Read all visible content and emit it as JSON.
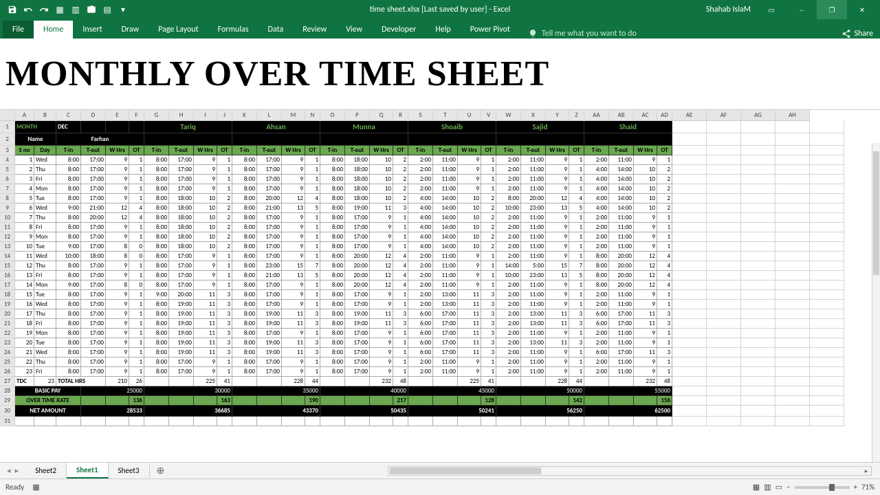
{
  "title": "time sheet.xlsx [Last saved by user]  -  Excel",
  "user": "Shahab IslaM",
  "ribbon": {
    "file": "File",
    "home": "Home",
    "insert": "Insert",
    "draw": "Draw",
    "layout": "Page Layout",
    "formulas": "Formulas",
    "data": "Data",
    "review": "Review",
    "view": "View",
    "dev": "Developer",
    "help": "Help",
    "pp": "Power Pivot",
    "tell": "Tell me what you want to do",
    "share": "Share"
  },
  "heading": "MONTHLY OVER TIME SHEET",
  "cols": [
    "A",
    "B",
    "C",
    "D",
    "E",
    "F",
    "G",
    "H",
    "I",
    "J",
    "K",
    "L",
    "M",
    "N",
    "O",
    "P",
    "Q",
    "R",
    "S",
    "T",
    "U",
    "V",
    "W",
    "X",
    "Y",
    "Z",
    "AA",
    "AB",
    "AC",
    "AD",
    "AE",
    "AF",
    "AG",
    "AH"
  ],
  "month_label": "MONTH",
  "month": "DEC",
  "name_label": "Name",
  "employees": [
    "Farhan",
    "Tariq",
    "Ahsan",
    "Munna",
    "Shoaib",
    "Sajid",
    "Shaid"
  ],
  "col_headers": [
    "S no",
    "Day",
    "T-in",
    "T-out",
    "W Hrs",
    "OT"
  ],
  "rown": [
    4,
    5,
    6,
    7,
    8,
    9,
    10,
    11,
    12,
    13,
    14,
    15,
    16,
    17,
    18,
    19,
    20,
    21,
    22,
    23,
    24,
    25,
    26,
    27,
    28,
    29,
    30,
    31
  ],
  "rows": [
    {
      "sno": 1,
      "day": "Wed",
      "cells": [
        [
          "8:00",
          "17:00",
          9,
          1
        ],
        [
          "8:00",
          "17:00",
          9,
          1
        ],
        [
          "8:00",
          "17:00",
          9,
          1
        ],
        [
          "8:00",
          "18:00",
          10,
          2
        ],
        [
          "2:00",
          "11:00",
          9,
          1
        ],
        [
          "2:00",
          "11:00",
          9,
          1
        ],
        [
          "2:00",
          "11:00",
          9,
          1
        ]
      ]
    },
    {
      "sno": 2,
      "day": "Thu",
      "cells": [
        [
          "8:00",
          "17:00",
          9,
          1
        ],
        [
          "8:00",
          "17:00",
          9,
          1
        ],
        [
          "8:00",
          "17:00",
          9,
          1
        ],
        [
          "8:00",
          "18:00",
          10,
          2
        ],
        [
          "2:00",
          "11:00",
          9,
          1
        ],
        [
          "2:00",
          "11:00",
          9,
          1
        ],
        [
          "4:00",
          "14:00",
          10,
          2
        ]
      ]
    },
    {
      "sno": 3,
      "day": "Fri",
      "cells": [
        [
          "8:00",
          "17:00",
          9,
          1
        ],
        [
          "8:00",
          "17:00",
          9,
          1
        ],
        [
          "8:00",
          "17:00",
          9,
          1
        ],
        [
          "8:00",
          "18:00",
          10,
          2
        ],
        [
          "2:00",
          "11:00",
          9,
          1
        ],
        [
          "2:00",
          "11:00",
          9,
          1
        ],
        [
          "4:00",
          "14:00",
          10,
          2
        ]
      ]
    },
    {
      "sno": 4,
      "day": "Mon",
      "cells": [
        [
          "8:00",
          "17:00",
          9,
          1
        ],
        [
          "8:00",
          "17:00",
          9,
          1
        ],
        [
          "8:00",
          "17:00",
          9,
          1
        ],
        [
          "8:00",
          "18:00",
          10,
          2
        ],
        [
          "2:00",
          "11:00",
          9,
          1
        ],
        [
          "2:00",
          "11:00",
          9,
          1
        ],
        [
          "4:00",
          "14:00",
          10,
          2
        ]
      ]
    },
    {
      "sno": 5,
      "day": "Tue",
      "cells": [
        [
          "8:00",
          "17:00",
          9,
          1
        ],
        [
          "8:00",
          "18:00",
          10,
          2
        ],
        [
          "8:00",
          "20:00",
          12,
          4
        ],
        [
          "8:00",
          "18:00",
          10,
          2
        ],
        [
          "4:00",
          "14:00",
          10,
          2
        ],
        [
          "8:00",
          "20:00",
          12,
          4
        ],
        [
          "4:00",
          "14:00",
          10,
          2
        ]
      ]
    },
    {
      "sno": 6,
      "day": "Wed",
      "cells": [
        [
          "9:00",
          "21:00",
          12,
          4
        ],
        [
          "8:00",
          "18:00",
          10,
          2
        ],
        [
          "8:00",
          "21:00",
          13,
          5
        ],
        [
          "8:00",
          "19:00",
          11,
          3
        ],
        [
          "4:00",
          "14:00",
          10,
          2
        ],
        [
          "10:00",
          "23:00",
          13,
          5
        ],
        [
          "4:00",
          "14:00",
          10,
          2
        ]
      ]
    },
    {
      "sno": 7,
      "day": "Thu",
      "cells": [
        [
          "8:00",
          "20:00",
          12,
          4
        ],
        [
          "8:00",
          "18:00",
          10,
          2
        ],
        [
          "8:00",
          "17:00",
          9,
          1
        ],
        [
          "8:00",
          "17:00",
          9,
          1
        ],
        [
          "4:00",
          "14:00",
          10,
          2
        ],
        [
          "2:00",
          "11:00",
          9,
          1
        ],
        [
          "2:00",
          "11:00",
          9,
          1
        ]
      ]
    },
    {
      "sno": 8,
      "day": "Fri",
      "cells": [
        [
          "8:00",
          "17:00",
          9,
          1
        ],
        [
          "8:00",
          "18:00",
          10,
          2
        ],
        [
          "8:00",
          "17:00",
          9,
          1
        ],
        [
          "8:00",
          "17:00",
          9,
          1
        ],
        [
          "4:00",
          "14:00",
          10,
          2
        ],
        [
          "2:00",
          "11:00",
          9,
          1
        ],
        [
          "2:00",
          "11:00",
          9,
          1
        ]
      ]
    },
    {
      "sno": 9,
      "day": "Mon",
      "cells": [
        [
          "8:00",
          "17:00",
          9,
          1
        ],
        [
          "8:00",
          "18:00",
          10,
          2
        ],
        [
          "8:00",
          "17:00",
          9,
          1
        ],
        [
          "8:00",
          "17:00",
          9,
          1
        ],
        [
          "4:00",
          "14:00",
          10,
          2
        ],
        [
          "2:00",
          "11:00",
          9,
          1
        ],
        [
          "2:00",
          "11:00",
          9,
          1
        ]
      ]
    },
    {
      "sno": 10,
      "day": "Tue",
      "cells": [
        [
          "9:00",
          "17:00",
          8,
          0
        ],
        [
          "8:00",
          "18:00",
          10,
          2
        ],
        [
          "8:00",
          "17:00",
          9,
          1
        ],
        [
          "8:00",
          "17:00",
          9,
          1
        ],
        [
          "4:00",
          "14:00",
          10,
          2
        ],
        [
          "2:00",
          "11:00",
          9,
          1
        ],
        [
          "2:00",
          "11:00",
          9,
          1
        ]
      ]
    },
    {
      "sno": 11,
      "day": "Wed",
      "cells": [
        [
          "10:00",
          "18:00",
          8,
          0
        ],
        [
          "8:00",
          "17:00",
          9,
          1
        ],
        [
          "8:00",
          "17:00",
          9,
          1
        ],
        [
          "8:00",
          "20:00",
          12,
          4
        ],
        [
          "2:00",
          "11:00",
          9,
          1
        ],
        [
          "2:00",
          "11:00",
          9,
          1
        ],
        [
          "8:00",
          "20:00",
          12,
          4
        ]
      ]
    },
    {
      "sno": 12,
      "day": "Thu",
      "cells": [
        [
          "8:00",
          "17:00",
          9,
          1
        ],
        [
          "8:00",
          "17:00",
          9,
          1
        ],
        [
          "8:00",
          "23:00",
          15,
          7
        ],
        [
          "8:00",
          "20:00",
          12,
          4
        ],
        [
          "2:00",
          "11:00",
          9,
          1
        ],
        [
          "14:00",
          "5:00",
          15,
          7
        ],
        [
          "8:00",
          "20:00",
          12,
          4
        ]
      ]
    },
    {
      "sno": 13,
      "day": "Fri",
      "cells": [
        [
          "8:00",
          "17:00",
          9,
          1
        ],
        [
          "8:00",
          "17:00",
          9,
          1
        ],
        [
          "8:00",
          "21:00",
          13,
          5
        ],
        [
          "8:00",
          "20:00",
          12,
          4
        ],
        [
          "2:00",
          "11:00",
          9,
          1
        ],
        [
          "10:00",
          "23:00",
          13,
          5
        ],
        [
          "8:00",
          "20:00",
          12,
          4
        ]
      ]
    },
    {
      "sno": 14,
      "day": "Mon",
      "cells": [
        [
          "9:00",
          "17:00",
          8,
          0
        ],
        [
          "8:00",
          "17:00",
          9,
          1
        ],
        [
          "8:00",
          "17:00",
          9,
          1
        ],
        [
          "8:00",
          "20:00",
          12,
          4
        ],
        [
          "2:00",
          "11:00",
          9,
          1
        ],
        [
          "2:00",
          "11:00",
          9,
          1
        ],
        [
          "8:00",
          "20:00",
          12,
          4
        ]
      ]
    },
    {
      "sno": 15,
      "day": "Tue",
      "cells": [
        [
          "8:00",
          "17:00",
          9,
          1
        ],
        [
          "9:00",
          "20:00",
          11,
          3
        ],
        [
          "8:00",
          "17:00",
          9,
          1
        ],
        [
          "8:00",
          "17:00",
          9,
          1
        ],
        [
          "2:00",
          "13:00",
          11,
          3
        ],
        [
          "2:00",
          "11:00",
          9,
          1
        ],
        [
          "2:00",
          "11:00",
          9,
          1
        ]
      ]
    },
    {
      "sno": 16,
      "day": "Wed",
      "cells": [
        [
          "8:00",
          "17:00",
          9,
          1
        ],
        [
          "8:00",
          "19:00",
          11,
          3
        ],
        [
          "8:00",
          "17:00",
          9,
          1
        ],
        [
          "8:00",
          "17:00",
          9,
          1
        ],
        [
          "2:00",
          "13:00",
          11,
          3
        ],
        [
          "2:00",
          "11:00",
          9,
          1
        ],
        [
          "2:00",
          "11:00",
          9,
          1
        ]
      ]
    },
    {
      "sno": 17,
      "day": "Thu",
      "cells": [
        [
          "8:00",
          "17:00",
          9,
          1
        ],
        [
          "8:00",
          "19:00",
          11,
          3
        ],
        [
          "8:00",
          "19:00",
          11,
          3
        ],
        [
          "8:00",
          "19:00",
          11,
          3
        ],
        [
          "6:00",
          "17:00",
          11,
          3
        ],
        [
          "2:00",
          "13:00",
          11,
          3
        ],
        [
          "6:00",
          "17:00",
          11,
          3
        ]
      ]
    },
    {
      "sno": 18,
      "day": "Fri",
      "cells": [
        [
          "8:00",
          "17:00",
          9,
          1
        ],
        [
          "8:00",
          "19:00",
          11,
          3
        ],
        [
          "8:00",
          "19:00",
          11,
          3
        ],
        [
          "8:00",
          "19:00",
          11,
          3
        ],
        [
          "6:00",
          "17:00",
          11,
          3
        ],
        [
          "2:00",
          "13:00",
          11,
          3
        ],
        [
          "6:00",
          "17:00",
          11,
          3
        ]
      ]
    },
    {
      "sno": 19,
      "day": "Mon",
      "cells": [
        [
          "8:00",
          "17:00",
          9,
          1
        ],
        [
          "8:00",
          "19:00",
          11,
          3
        ],
        [
          "8:00",
          "17:00",
          9,
          1
        ],
        [
          "8:00",
          "17:00",
          9,
          1
        ],
        [
          "6:00",
          "17:00",
          11,
          3
        ],
        [
          "2:00",
          "11:00",
          9,
          1
        ],
        [
          "2:00",
          "11:00",
          9,
          1
        ]
      ]
    },
    {
      "sno": 20,
      "day": "Tue",
      "cells": [
        [
          "8:00",
          "17:00",
          9,
          1
        ],
        [
          "8:00",
          "19:00",
          11,
          3
        ],
        [
          "8:00",
          "19:00",
          11,
          3
        ],
        [
          "8:00",
          "17:00",
          9,
          1
        ],
        [
          "6:00",
          "17:00",
          11,
          3
        ],
        [
          "2:00",
          "13:00",
          11,
          3
        ],
        [
          "2:00",
          "11:00",
          9,
          1
        ]
      ]
    },
    {
      "sno": 21,
      "day": "Wed",
      "cells": [
        [
          "8:00",
          "17:00",
          9,
          1
        ],
        [
          "8:00",
          "19:00",
          11,
          3
        ],
        [
          "8:00",
          "19:00",
          11,
          3
        ],
        [
          "8:00",
          "17:00",
          9,
          1
        ],
        [
          "6:00",
          "17:00",
          11,
          3
        ],
        [
          "2:00",
          "11:00",
          9,
          1
        ],
        [
          "6:00",
          "17:00",
          11,
          3
        ]
      ]
    },
    {
      "sno": 22,
      "day": "Thu",
      "cells": [
        [
          "8:00",
          "17:00",
          9,
          1
        ],
        [
          "8:00",
          "17:00",
          9,
          1
        ],
        [
          "8:00",
          "17:00",
          9,
          1
        ],
        [
          "8:00",
          "17:00",
          9,
          1
        ],
        [
          "2:00",
          "11:00",
          9,
          1
        ],
        [
          "2:00",
          "11:00",
          9,
          1
        ],
        [
          "2:00",
          "11:00",
          9,
          1
        ]
      ]
    },
    {
      "sno": 23,
      "day": "Fri",
      "cells": [
        [
          "8:00",
          "17:00",
          9,
          1
        ],
        [
          "8:00",
          "17:00",
          9,
          1
        ],
        [
          "8:00",
          "17:00",
          9,
          1
        ],
        [
          "8:00",
          "17:00",
          9,
          1
        ],
        [
          "2:00",
          "11:00",
          9,
          1
        ],
        [
          "2:00",
          "11:00",
          9,
          1
        ],
        [
          "2:00",
          "11:00",
          9,
          1
        ]
      ]
    }
  ],
  "totals": {
    "label": "TOTAL HRS",
    "tdc": "TDC",
    "tdc_val": 23,
    "hrs": [
      210,
      225,
      228,
      232,
      225,
      228,
      232
    ],
    "ot": [
      26,
      41,
      44,
      48,
      41,
      44,
      48
    ]
  },
  "basic": {
    "label": "BASIC PAY",
    "vals": [
      25000,
      30000,
      35000,
      40000,
      45000,
      50000,
      55000
    ]
  },
  "otrate": {
    "label": "OVER TIME RATE",
    "vals": [
      136,
      163,
      190,
      217,
      128,
      142,
      156
    ]
  },
  "net": {
    "label": "NET AMOUNT",
    "vals": [
      28533,
      36685,
      43370,
      50435,
      50241,
      56250,
      62500
    ]
  },
  "sheets": [
    "Sheet2",
    "Sheet1",
    "Sheet3"
  ],
  "status": {
    "ready": "Ready",
    "zoom": "71%"
  }
}
